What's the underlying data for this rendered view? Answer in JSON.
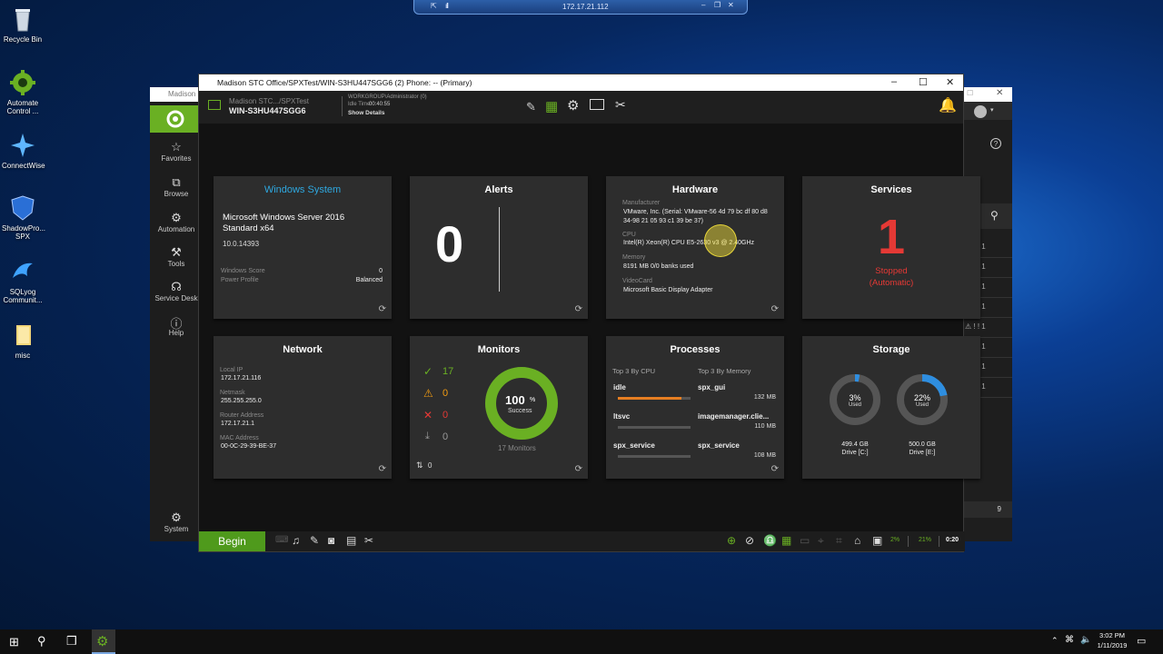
{
  "rdp": {
    "address": "172.17.21.112"
  },
  "desktop": {
    "icons": [
      {
        "label": "Recycle Bin"
      },
      {
        "label": "Automate Control ..."
      },
      {
        "label": "ConnectWise"
      },
      {
        "label": "ShadowPro... SPX"
      },
      {
        "label": "SQLyog Communit..."
      },
      {
        "label": "misc"
      }
    ]
  },
  "back_window": {
    "title": "Madison",
    "sidebar": [
      {
        "label": "Favorites",
        "icon": "star-icon"
      },
      {
        "label": "Browse",
        "icon": "browse-icon"
      },
      {
        "label": "Automation",
        "icon": "gear-icon"
      },
      {
        "label": "Tools",
        "icon": "hammer-icon"
      },
      {
        "label": "Service Desk",
        "icon": "headset-icon"
      },
      {
        "label": "Help",
        "icon": "help-icon"
      },
      {
        "label": "System",
        "icon": "gear-icon"
      }
    ],
    "right_footer_count": "9"
  },
  "window": {
    "title": "Madison STC Office/SPXTest/WIN-S3HU447SGG6 (2) Phone: -- (Primary)",
    "machine_path": "Madison STC.../SPXTest",
    "machine_name": "WIN-S3HU447SGG6",
    "user": "WORKGROUP\\Administrator (0)",
    "idle_label": "Idle Time:",
    "idle_value": "00:40:55",
    "show_details": "Show Details"
  },
  "tiles": {
    "windows": {
      "title": "Windows System",
      "os": "Microsoft Windows Server 2016 Standard x64",
      "version": "10.0.14393",
      "score_label": "Windows Score",
      "score_value": "0",
      "power_label": "Power Profile",
      "power_value": "Balanced"
    },
    "alerts": {
      "title": "Alerts",
      "count": "0"
    },
    "hardware": {
      "title": "Hardware",
      "manufacturer_label": "Manufacturer",
      "manufacturer": "VMware, Inc. (Serial: VMware-56 4d 79 bc df 80 d8 34-98 21 05 93 c1 39 be 37)",
      "cpu_label": "CPU",
      "cpu": "Intel(R) Xeon(R) CPU E5-2630 v3 @ 2.40GHz",
      "memory_label": "Memory",
      "memory": "8191 MB 0/0 banks used",
      "video_label": "VideoCard",
      "video": "Microsoft Basic Display Adapter"
    },
    "services": {
      "title": "Services",
      "count": "1",
      "status": "Stopped (Automatic)"
    },
    "network": {
      "title": "Network",
      "local_ip_label": "Local IP",
      "local_ip": "172.17.21.116",
      "netmask_label": "Netmask",
      "netmask": "255.255.255.0",
      "router_label": "Router Address",
      "router": "172.17.21.1",
      "mac_label": "MAC Address",
      "mac": "00-0C-29-39-BE-37"
    },
    "monitors": {
      "title": "Monitors",
      "ok": "17",
      "warn": "0",
      "fail": "0",
      "down": "0",
      "percent": "100",
      "percent_unit": "%",
      "success_label": "Success",
      "total_label": "17  Monitors",
      "sort_count": "0",
      "success_fraction": 1.0
    },
    "processes": {
      "title": "Processes",
      "cpu_header": "Top 3 By CPU",
      "mem_header": "Top 3 By Memory",
      "cpu": [
        {
          "name": "idle",
          "fraction": 0.88
        },
        {
          "name": "ltsvc",
          "fraction": 0.0
        },
        {
          "name": "spx_service",
          "fraction": 0.0
        }
      ],
      "mem": [
        {
          "name": "spx_gui",
          "value": "132 MB"
        },
        {
          "name": "imagemanager.clie...",
          "value": "110 MB"
        },
        {
          "name": "spx_service",
          "value": "108 MB"
        }
      ]
    },
    "storage": {
      "title": "Storage",
      "drives": [
        {
          "percent": "3%",
          "used_label": "Used",
          "size": "499.4 GB",
          "drive": "Drive [C:]",
          "fraction": 0.03
        },
        {
          "percent": "22%",
          "used_label": "Used",
          "size": "500.0 GB",
          "drive": "Drive [E:]",
          "fraction": 0.22
        }
      ]
    }
  },
  "bottom": {
    "begin": "Begin",
    "cpu_percent": "2%",
    "mem_percent": "21%",
    "elapsed": "0:20"
  },
  "taskbar": {
    "time": "3:02 PM",
    "date": "1/11/2019"
  },
  "colors": {
    "accent_green": "#6ab023",
    "title_blue": "#2ea8e0",
    "alert_red": "#e53935",
    "warn_orange": "#f39c12"
  }
}
